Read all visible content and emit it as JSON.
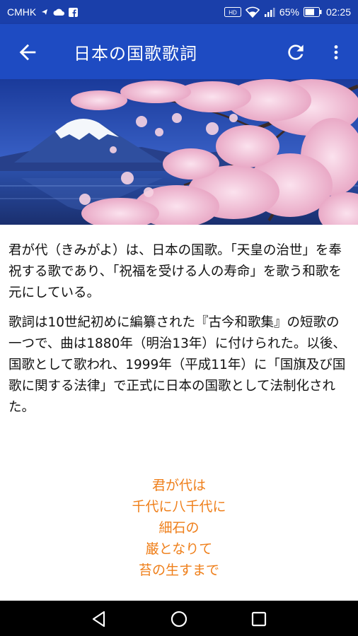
{
  "status_bar": {
    "carrier": "CMHK",
    "battery": "65%",
    "time": "02:25",
    "hd_badge": "HD"
  },
  "app_bar": {
    "title": "日本の国歌歌詞"
  },
  "content": {
    "paragraphs": [
      "君が代（きみがよ）は、日本の国歌。「天皇の治世」を奉祝する歌であり、「祝福を受ける人の寿命」を歌う和歌を元にしている。",
      "歌詞は10世紀初めに編纂された『古今和歌集』の短歌の一つで、曲は1880年（明治13年）に付けられた。以後、国歌として歌われ、1999年（平成11年）に「国旗及び国歌に関する法律」で正式に日本の国歌として法制化された。"
    ]
  },
  "poem": {
    "lines": [
      "君が代は",
      "千代に八千代に",
      "細石の",
      "巌となりて",
      "苔の生すまで"
    ]
  },
  "colors": {
    "status_bar": "#1a3faa",
    "app_bar": "#1e4bc2",
    "poem_text": "#ef7f1a",
    "body_text": "#111111"
  },
  "icons": {
    "back": "arrow-back-icon",
    "refresh": "refresh-icon",
    "more": "more-vert-icon",
    "nav_back": "triangle-back-icon",
    "nav_home": "circle-home-icon",
    "nav_recents": "square-recents-icon"
  }
}
